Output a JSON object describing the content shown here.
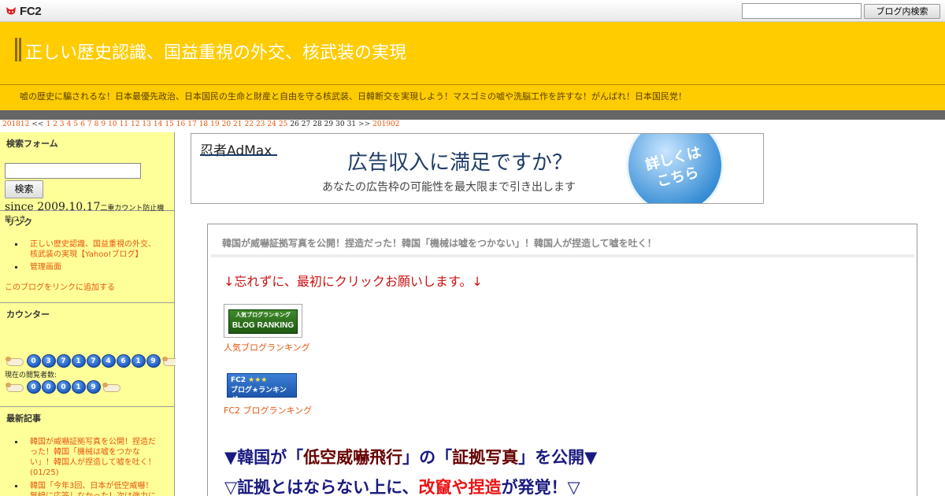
{
  "fc2bar": {
    "logo_text": "FC2",
    "search_value": "",
    "search_button": "ブログ内検索"
  },
  "header": {
    "title": "正しい歴史認識、国益重視の外交、核武装の実現",
    "description": "嘘の歴史に騙されるな！日本最優先政治、日本国民の生命と財産と自由を守る核武装、日韓断交を実現しよう！マスゴミの嘘や洗脳工作を許すな！がんばれ！日本国民党！",
    "accent_color": "#ffcc00"
  },
  "calendar": {
    "prev": "201812",
    "prev_arrow": "<<",
    "linked_days": [
      "1",
      "2",
      "3",
      "4",
      "5",
      "6",
      "7",
      "8",
      "9",
      "10",
      "11",
      "12",
      "13",
      "14",
      "15",
      "16",
      "17",
      "18",
      "19",
      "20",
      "21",
      "22",
      "23",
      "24",
      "25"
    ],
    "plain_days": [
      "26",
      "27",
      "28",
      "29",
      "30",
      "31"
    ],
    "next_arrow": ">>",
    "next": "201902"
  },
  "sidebar": {
    "search": {
      "heading": "検索フォーム",
      "value": "",
      "button": "検索"
    },
    "links": {
      "heading": "リンク",
      "items": [
        "正しい歴史認識、国益重視の外交、核武装の実現【Yahoo!ブログ】",
        "管理画面"
      ],
      "add_link": "このブログをリンクに追加する"
    },
    "counter": {
      "heading": "カウンター",
      "since": "since 2009.10.17",
      "since_note": "二重カウント防止機",
      "since_note2": "能つき",
      "digits": [
        "0",
        "3",
        "7",
        "1",
        "7",
        "4",
        "6",
        "1",
        "9"
      ],
      "visitors_label": "現在の閲覧者数:",
      "visitor_digits": [
        "0",
        "0",
        "0",
        "1",
        "9"
      ]
    },
    "recent": {
      "heading": "最新記事",
      "items": [
        "韓国が威嚇証拠写真を公開！捏造だった！韓国「機械は嘘をつかない」！韓国人が捏造して嘘を吐く！(01/25)",
        "韓国「今年3回、日本が低空威嚇！無線に応答しなかった！次は強力に"
      ]
    }
  },
  "ad": {
    "brand": "忍者AdMax",
    "headline": "広告収入に満足ですか？",
    "sub": "あなたの広告枠の可能性を最大限まで引き出します",
    "cta": "詳しくはこちら"
  },
  "entry": {
    "title": "韓国が威嚇証拠写真を公開！捏造だった！韓国「機械は嘘をつかない」！韓国人が捏造して嘘を吐く！",
    "click_request": "↓忘れずに、最初にクリックお願いします。↓",
    "banner1_jp": "人気ブログランキング",
    "banner1_en": "BLOG RANKING",
    "rank1": "人気ブログランキング",
    "banner2_top": "FC2",
    "banner2_stars": "★★★",
    "banner2_bottom": "ブログ★ランキング",
    "rank2": "FC2 ブログランキング",
    "heading1_pre": "▼韓国が「",
    "heading1_mid1": "低空威嚇飛行",
    "heading1_mid2": "」の「",
    "heading1_mid3": "証拠写真",
    "heading1_post": "」を公開▼",
    "heading2_pre": "▽証拠とはならない上に、",
    "heading2_red": "改竄や捏造",
    "heading2_post": "が発覚！▽"
  }
}
